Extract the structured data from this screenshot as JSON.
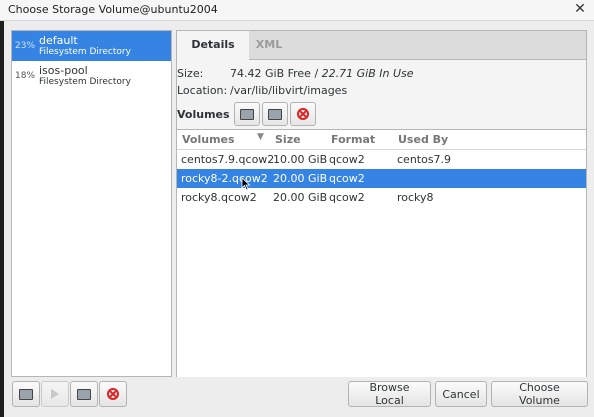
{
  "window": {
    "title": "Choose Storage Volume@ubuntu2004",
    "close_glyph": "✕"
  },
  "pools": [
    {
      "percent": "23%",
      "name": "default",
      "type": "Filesystem Directory",
      "selected": true
    },
    {
      "percent": "18%",
      "name": "isos-pool",
      "type": "Filesystem Directory",
      "selected": false
    }
  ],
  "tabs": {
    "details": "Details",
    "xml": "XML"
  },
  "details": {
    "size_label": "Size:",
    "free": "74.42 GiB Free",
    "sep": " / ",
    "in_use": "22.71 GiB In Use",
    "location_label": "Location:",
    "location": "/var/lib/libvirt/images",
    "volumes_label": "Volumes"
  },
  "volume_table": {
    "headers": {
      "name": "Volumes",
      "size": "Size",
      "format": "Format",
      "used_by": "Used By"
    },
    "rows": [
      {
        "name": "centos7.9.qcow2",
        "size": "10.00 GiB",
        "format": "qcow2",
        "used_by": "centos7.9",
        "selected": false
      },
      {
        "name": "rocky8-2.qcow2",
        "size": "20.00 GiB",
        "format": "qcow2",
        "used_by": "",
        "selected": true
      },
      {
        "name": "rocky8.qcow2",
        "size": "20.00 GiB",
        "format": "qcow2",
        "used_by": "rocky8",
        "selected": false
      }
    ]
  },
  "buttons": {
    "browse_local": "Browse Local",
    "cancel": "Cancel",
    "choose_volume": "Choose Volume"
  },
  "icons": {
    "new_volume": "new-volume-icon",
    "refresh": "refresh-icon",
    "delete": "delete-icon",
    "add_pool": "add-pool-icon",
    "start_pool": "start-pool-icon",
    "stop_pool": "stop-pool-icon"
  },
  "colors": {
    "selection": "#3584e4",
    "delete": "#dd2222"
  }
}
